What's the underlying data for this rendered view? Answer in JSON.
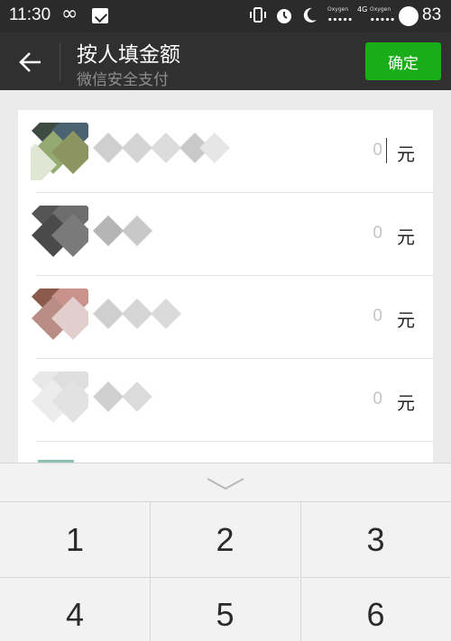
{
  "status_bar": {
    "time": "11:30",
    "infinity": "∞",
    "network_label_1": "Oxygen",
    "network_label_2": "Oxygen",
    "network_type": "4G",
    "battery_level": "83"
  },
  "header": {
    "title": "按人填金额",
    "subtitle": "微信安全支付",
    "confirm_label": "确定"
  },
  "recipients": [
    {
      "amount": "0",
      "unit": "元"
    },
    {
      "amount": "0",
      "unit": "元"
    },
    {
      "amount": "0",
      "unit": "元"
    },
    {
      "amount": "0",
      "unit": "元"
    }
  ],
  "keypad": {
    "keys": [
      "1",
      "2",
      "3",
      "4",
      "5",
      "6"
    ]
  },
  "colors": {
    "accent": "#1aad19",
    "title_bar": "#303030",
    "status_bar": "#2b2b2b"
  }
}
